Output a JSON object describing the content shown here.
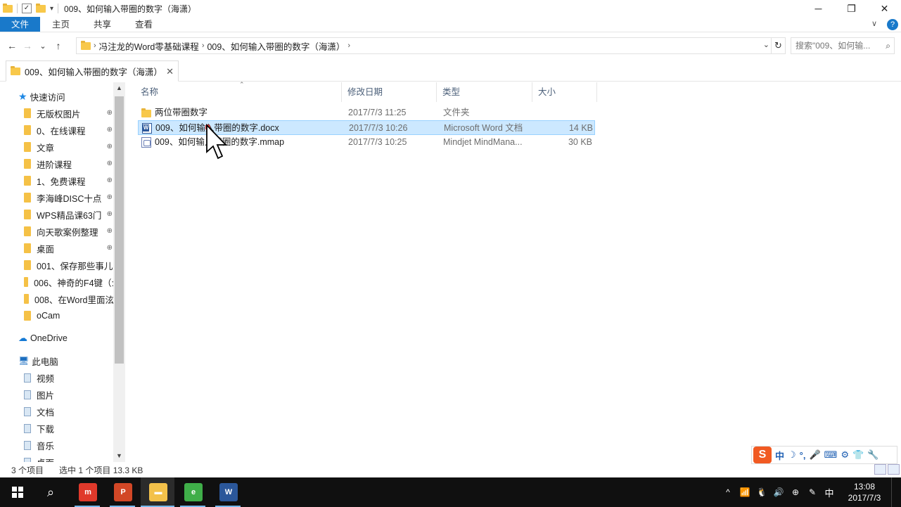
{
  "window": {
    "title": "009、如何输入带圈的数字（海潇）",
    "controls": {
      "minimize": "─",
      "maximize": "❐",
      "close": "✕"
    }
  },
  "ribbon": {
    "tabs": [
      "文件",
      "主页",
      "共享",
      "查看"
    ],
    "expand": "∨",
    "help": "?"
  },
  "address": {
    "back": "←",
    "forward": "→",
    "recent": "⌄",
    "up": "↑",
    "path": [
      "冯注龙的Word零基础课程",
      "009、如何输入带圈的数字（海潇）"
    ],
    "separator": "›",
    "dropdown": "⌄",
    "refresh": "↻",
    "search_placeholder": "搜索\"009、如何输...",
    "search_icon": "⌕"
  },
  "folder_tab": {
    "label": "009、如何输入带圈的数字（海潇）",
    "close": "✕"
  },
  "nav": {
    "quick_access": "快速访问",
    "quick_items": [
      {
        "label": "无版权图片",
        "pinned": true
      },
      {
        "label": "0、在线课程",
        "pinned": true
      },
      {
        "label": "文章",
        "pinned": true
      },
      {
        "label": "进阶课程",
        "pinned": true
      },
      {
        "label": "1、免费课程",
        "pinned": true
      },
      {
        "label": "李海峰DISC十点",
        "pinned": true
      },
      {
        "label": "WPS精品课63门",
        "pinned": true
      },
      {
        "label": "向天歌案例整理",
        "pinned": true
      },
      {
        "label": "桌面",
        "pinned": true
      },
      {
        "label": "001、保存那些事儿",
        "pinned": false
      },
      {
        "label": "006、神奇的F4键（:",
        "pinned": false
      },
      {
        "label": "008、在Word里面泫",
        "pinned": false
      },
      {
        "label": "oCam",
        "pinned": false
      }
    ],
    "onedrive": "OneDrive",
    "this_pc": "此电脑",
    "pc_items": [
      "视频",
      "图片",
      "文档",
      "下载",
      "音乐",
      "桌面"
    ],
    "pin_glyph": "📌"
  },
  "columns": {
    "name": "名称",
    "date": "修改日期",
    "type": "类型",
    "size": "大小"
  },
  "files": [
    {
      "name": "两位带圈数字",
      "date": "2017/7/3 11:25",
      "type": "文件夹",
      "size": "",
      "icon": "folder-icon",
      "selected": false
    },
    {
      "name": "009、如何输入带圈的数字.docx",
      "date": "2017/7/3 10:26",
      "type": "Microsoft Word 文档",
      "size": "14 KB",
      "icon": "word-doc-icon",
      "selected": true
    },
    {
      "name": "009、如何输入带圈的数字.mmap",
      "date": "2017/7/3 10:25",
      "type": "Mindjet MindMana...",
      "size": "30 KB",
      "icon": "mindmanager-icon",
      "selected": false
    }
  ],
  "status": {
    "count": "3 个项目",
    "selection": "选中 1 个项目  13.3 KB"
  },
  "ime": {
    "logo": "S",
    "items": [
      "中",
      "☽",
      "°,",
      "🎤",
      "⌨",
      "⚙",
      "👕",
      "🔧"
    ]
  },
  "taskbar": {
    "apps": [
      {
        "name": "app-red",
        "glyph": "m",
        "color": "#e0392b"
      },
      {
        "name": "app-ppt",
        "glyph": "P",
        "color": "#d24726"
      },
      {
        "name": "file-explorer",
        "glyph": "▬",
        "color": "#f3c14a"
      },
      {
        "name": "browser",
        "glyph": "e",
        "color": "#3fae49"
      },
      {
        "name": "word",
        "glyph": "W",
        "color": "#2b579a"
      }
    ],
    "tray": [
      "^",
      "📶",
      "🐧",
      "🔊",
      "⊕",
      "✎"
    ],
    "ime_indicator": "中",
    "time": "13:08",
    "date": "2017/7/3"
  },
  "colors": {
    "accent": "#1979ca",
    "selection": "#cce8ff",
    "taskbar": "#101010"
  }
}
